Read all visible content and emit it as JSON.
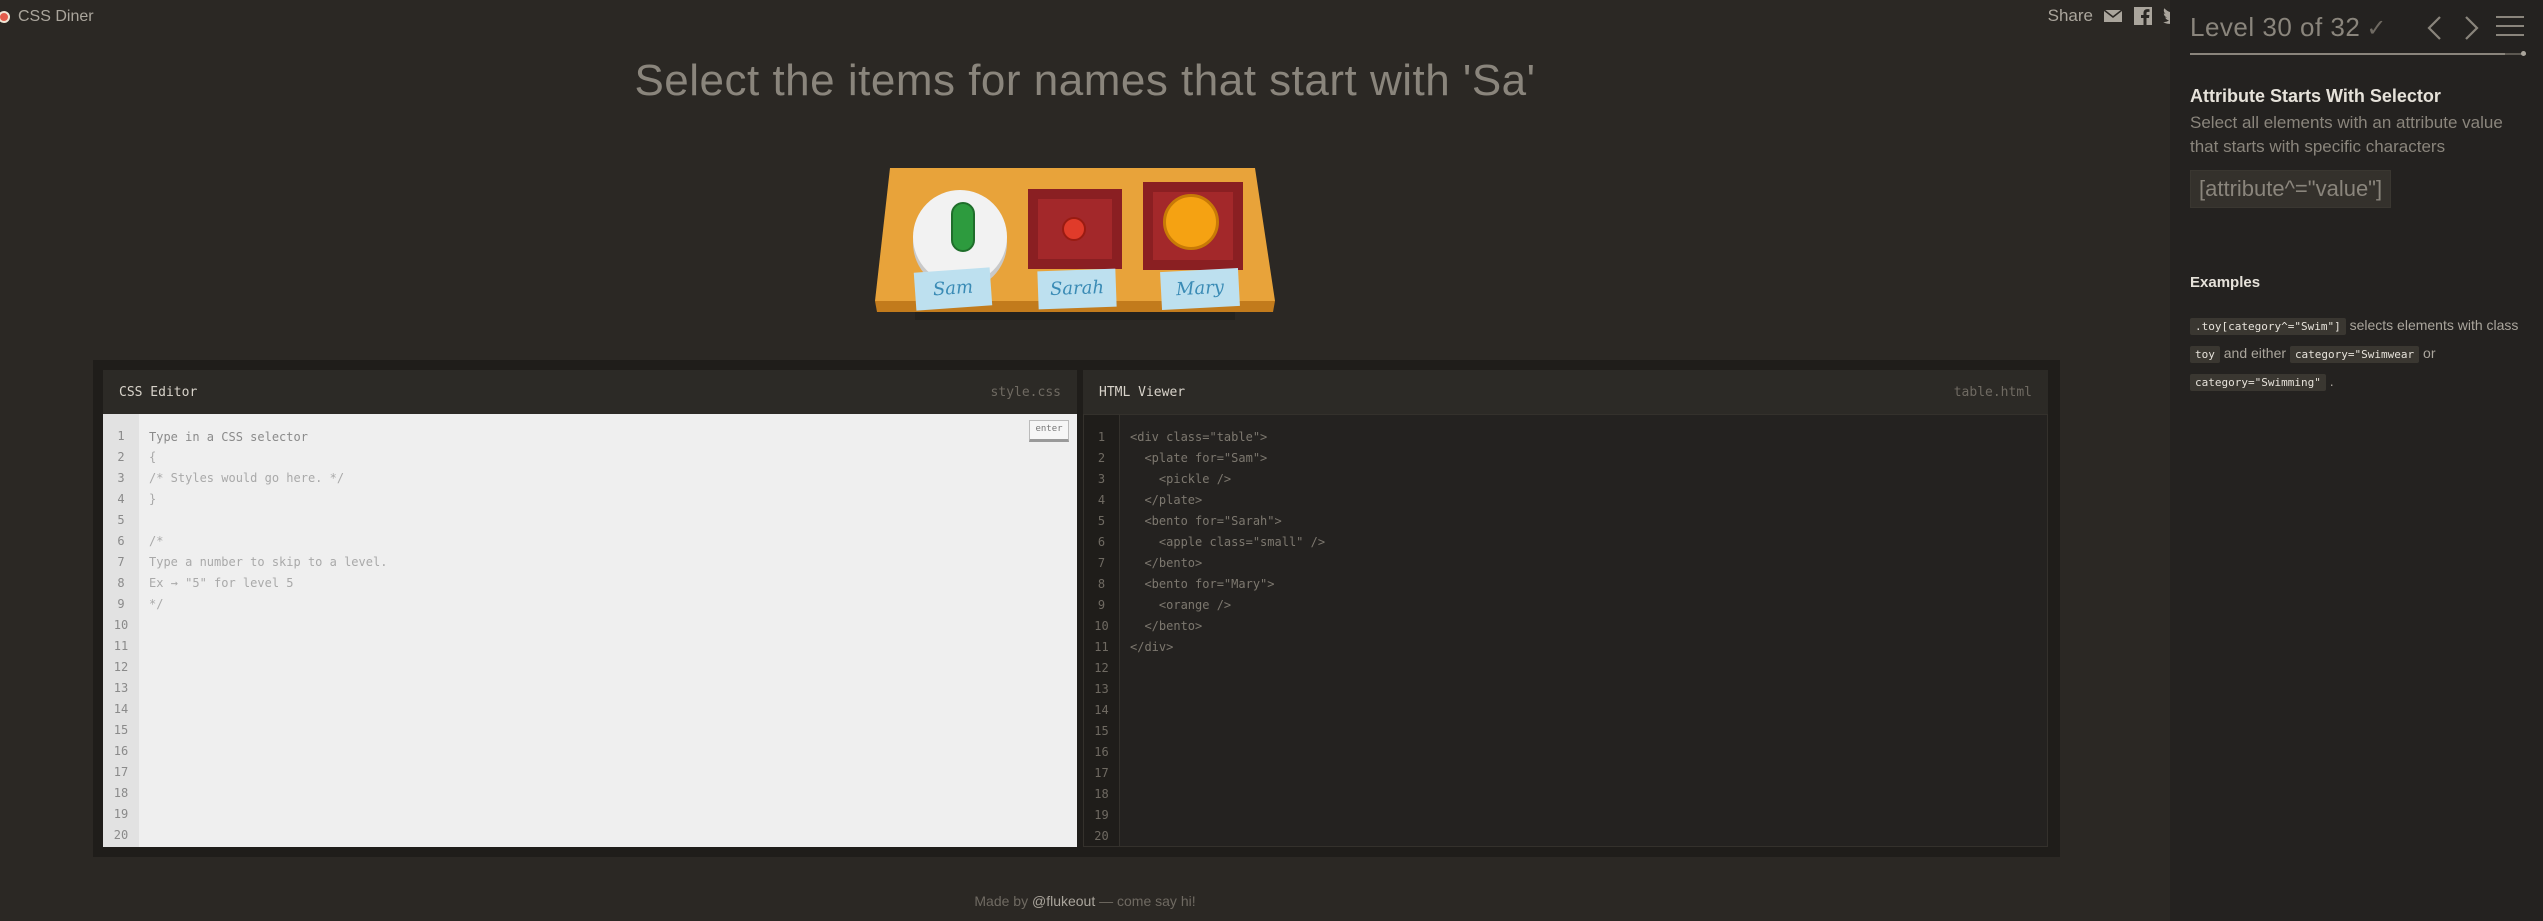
{
  "app": {
    "title": "CSS Diner"
  },
  "share": {
    "label": "Share",
    "icons": [
      "mail-icon",
      "facebook-icon",
      "twitter-icon"
    ]
  },
  "level": {
    "title": "Level 30 of 32",
    "current": 30,
    "total": 32,
    "progress": 0.9375,
    "completed": true
  },
  "task": {
    "instruction": "Select the items for names that start with 'Sa'"
  },
  "table": {
    "items": [
      {
        "kind": "plate",
        "name": "Sam"
      },
      {
        "kind": "bento",
        "name": "Sarah"
      },
      {
        "kind": "bento",
        "name": "Mary"
      }
    ]
  },
  "sidebar": {
    "selector_name": "Attribute Starts With Selector",
    "description": "Select all elements with an attribute value that starts with specific characters",
    "syntax": "[attribute^=\"value\"]",
    "examples_title": "Examples",
    "example": {
      "code1": ".toy[category^=\"Swim\"]",
      "text1": "selects elements with class",
      "code2": "toy",
      "text2": "and either",
      "code3": "category=\"Swimwear",
      "text3": "or",
      "code4": "category=\"Swimming\"",
      "text4": "."
    }
  },
  "css_editor": {
    "title": "CSS Editor",
    "filename": "style.css",
    "placeholder": "Type in a CSS selector",
    "enter_label": "enter",
    "lines": "{\n/* Styles would go here. */\n}\n\n/*\nType a number to skip to a level.\nEx → \"5\" for level 5\n*/",
    "line_numbers": "1\n2\n3\n4\n5\n6\n7\n8\n9\n10\n11\n12\n13\n14\n15\n16\n17\n18\n19\n20"
  },
  "html_viewer": {
    "title": "HTML Viewer",
    "filename": "table.html",
    "lines": "<div class=\"table\">\n  <plate for=\"Sam\">\n    <pickle />\n  </plate>\n  <bento for=\"Sarah\">\n    <apple class=\"small\" />\n  </bento>\n  <bento for=\"Mary\">\n    <orange />\n  </bento>\n</div>",
    "line_numbers": "1\n2\n3\n4\n5\n6\n7\n8\n9\n10\n11\n12\n13\n14\n15\n16\n17\n18\n19\n20"
  },
  "footer": {
    "prefix": "Made by ",
    "handle": "@flukeout",
    "suffix": " — come say hi!"
  },
  "colors": {
    "background": "#2b2824",
    "sidebar": "#242220",
    "table": "#e8a33a",
    "bento": "#a3282a"
  }
}
